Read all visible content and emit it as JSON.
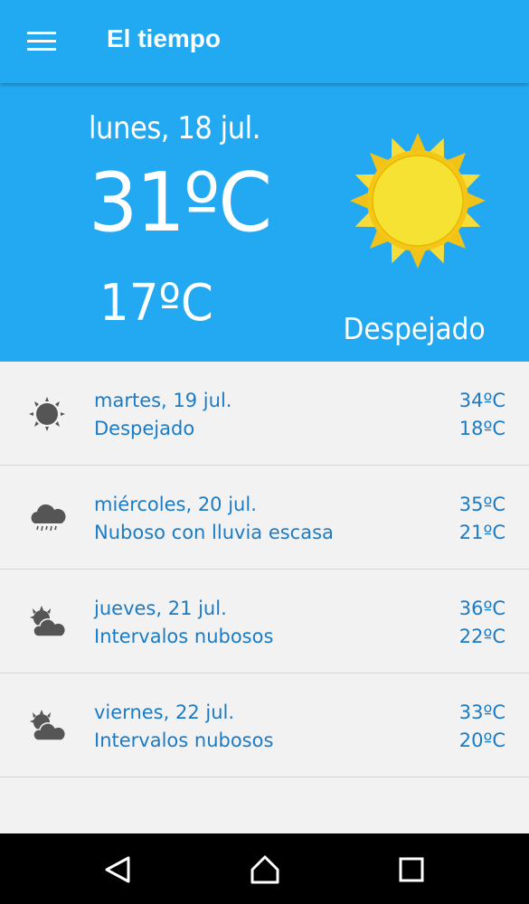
{
  "app": {
    "title": "El tiempo"
  },
  "today": {
    "date": "lunes, 18 jul.",
    "max": "31ºC",
    "min": "17ºC",
    "condition": "Despejado",
    "icon": "sun-icon"
  },
  "forecast": [
    {
      "date": "martes, 19 jul.",
      "condition": "Despejado",
      "max": "34ºC",
      "min": "18ºC",
      "icon": "sun-icon"
    },
    {
      "date": "miércoles, 20 jul.",
      "condition": "Nuboso con lluvia escasa",
      "max": "35ºC",
      "min": "21ºC",
      "icon": "rain-cloud-icon"
    },
    {
      "date": "jueves, 21 jul.",
      "condition": "Intervalos nubosos",
      "max": "36ºC",
      "min": "22ºC",
      "icon": "partly-cloudy-icon"
    },
    {
      "date": "viernes, 22 jul.",
      "condition": "Intervalos nubosos",
      "max": "33ºC",
      "min": "20ºC",
      "icon": "partly-cloudy-icon"
    }
  ],
  "colors": {
    "primary": "#21aaf2",
    "list_text": "#1b7bc4",
    "sun": "#f5e232"
  }
}
